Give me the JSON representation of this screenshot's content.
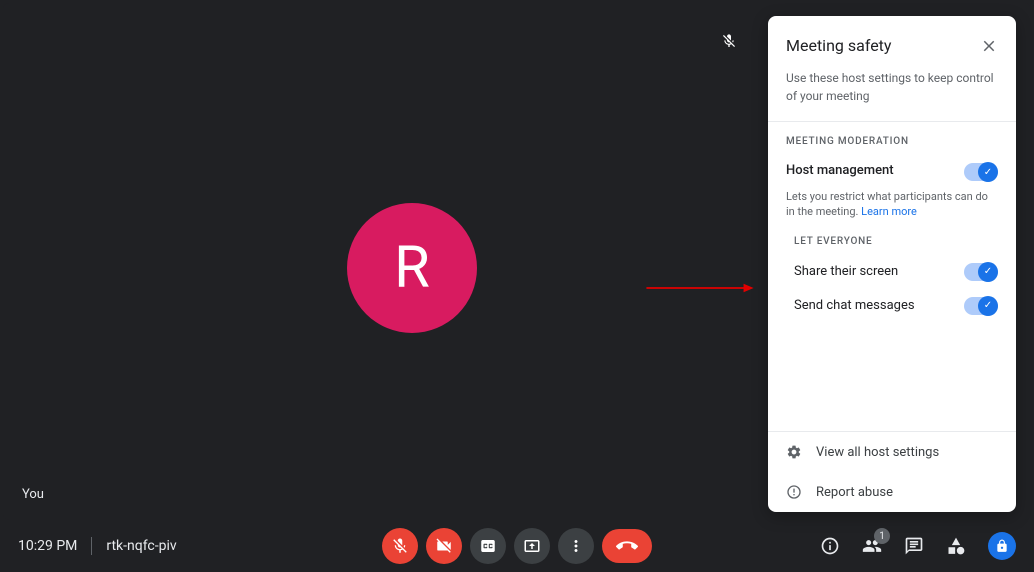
{
  "main": {
    "avatar_initial": "R",
    "you_label": "You"
  },
  "bottom": {
    "time": "10:29 PM",
    "meeting_code": "rtk-nqfc-piv",
    "participants_count": "1"
  },
  "panel": {
    "title": "Meeting safety",
    "subtitle": "Use these host settings to keep control of your meeting",
    "section_moderation": "MEETING MODERATION",
    "host_mgmt_title": "Host management",
    "host_mgmt_desc": "Lets you restrict what participants can do in the meeting. ",
    "learn_more": "Learn more",
    "let_everyone": "LET EVERYONE",
    "share_screen": "Share their screen",
    "send_chat": "Send chat messages",
    "footer_all_settings": "View all host settings",
    "footer_report": "Report abuse"
  }
}
